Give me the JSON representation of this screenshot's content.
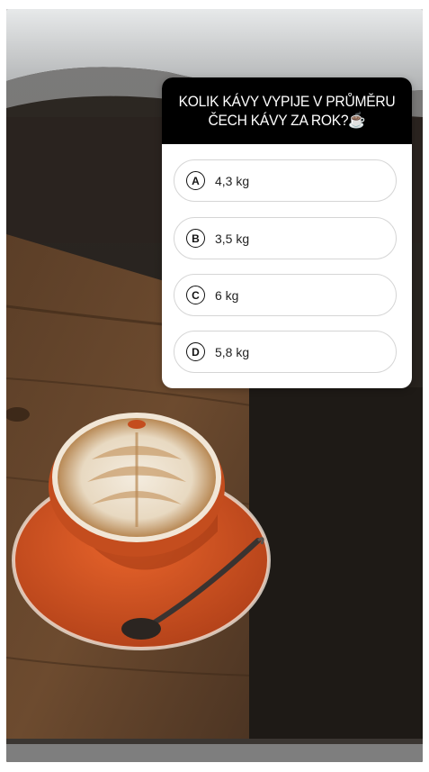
{
  "story": {
    "background": "coffee-latte-art-photo",
    "colors": {
      "card": "#ffffff",
      "header": "#000000",
      "saucer": "#d4521f",
      "foam": "#efe4d3"
    }
  },
  "quiz": {
    "question": "KOLIK KÁVY VYPIJE V PRŮMĚRU ČECH KÁVY ZA ROK?☕",
    "options": [
      {
        "letter": "A",
        "text": "4,3 kg"
      },
      {
        "letter": "B",
        "text": "3,5 kg"
      },
      {
        "letter": "C",
        "text": "6 kg"
      },
      {
        "letter": "D",
        "text": "5,8 kg"
      }
    ]
  }
}
